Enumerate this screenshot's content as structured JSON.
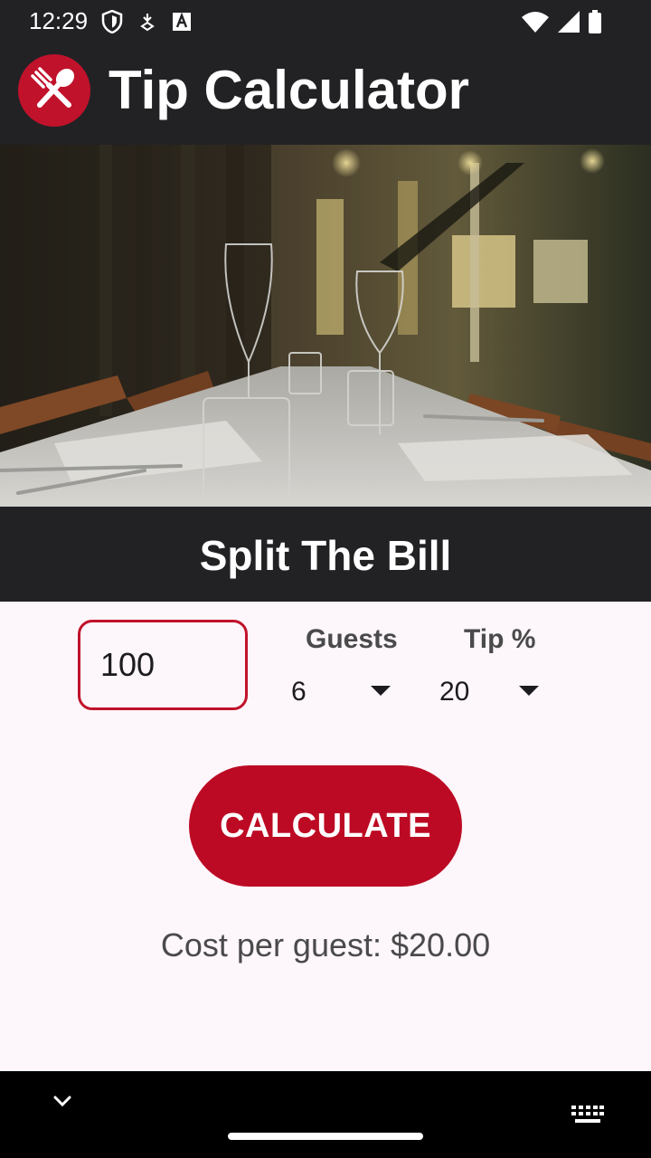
{
  "status_bar": {
    "time": "12:29",
    "left_icons": [
      "shield-icon",
      "location-icon",
      "font-a-icon"
    ],
    "right_icons": [
      "wifi-icon",
      "signal-icon",
      "battery-icon"
    ]
  },
  "app_bar": {
    "title": "Tip Calculator",
    "logo_icon": "fork-spoon-icon",
    "logo_color": "#c1122b"
  },
  "hero": {
    "subject": "restaurant table with wine glasses"
  },
  "section": {
    "title": "Split The Bill"
  },
  "form": {
    "bill_value": "100",
    "guests_label": "Guests",
    "guests_value": "6",
    "tip_label": "Tip %",
    "tip_value": "20",
    "calculate_label": "CALCULATE"
  },
  "result": {
    "text": "Cost per guest: $20.00"
  },
  "colors": {
    "accent": "#bd0a24",
    "dark": "#222225",
    "background": "#fdf6fb"
  }
}
